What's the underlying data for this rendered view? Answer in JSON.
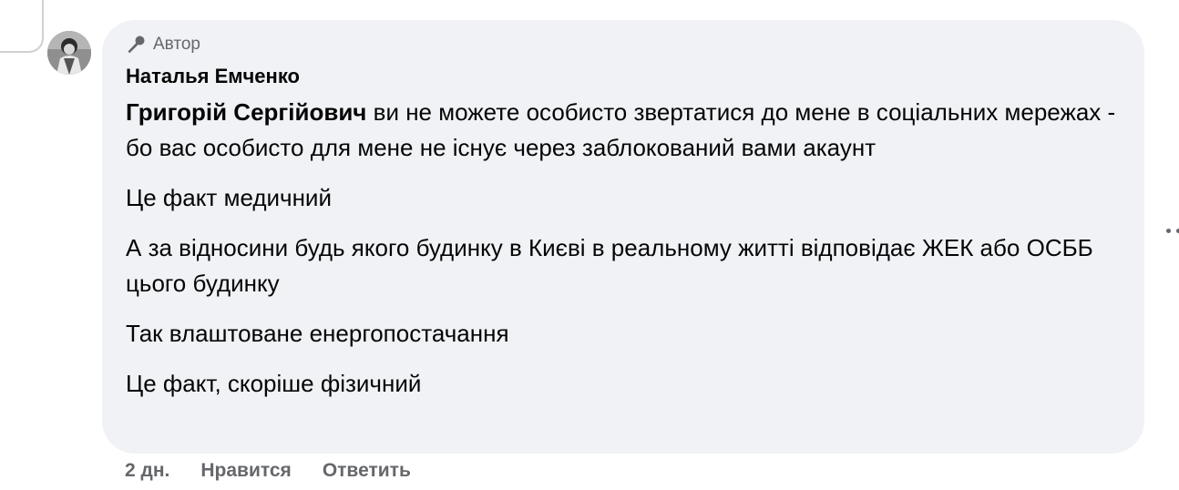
{
  "comment": {
    "badge": "Автор",
    "badge_icon": "microphone-icon",
    "author": "Наталья Емченко",
    "mention": "Григорій Сергійович",
    "paragraphs": [
      " ви не можете особисто звертатися до мене в соціальних мережах - бо вас особисто для мене не існує через заблокований вами акаунт",
      "Це факт медичний",
      "А за відносини будь якого будинку в Києві в реальному житті відповідає ЖЕК або ОСББ цього будинку",
      "Так влаштоване енергопостачання",
      "Це факт, скоріше фізичний"
    ]
  },
  "actions": {
    "time": "2 дн.",
    "like": "Нравится",
    "reply": "Ответить"
  },
  "colors": {
    "bubble": "#f0f2f5",
    "secondary_text": "#65676b",
    "primary_text": "#050505"
  }
}
